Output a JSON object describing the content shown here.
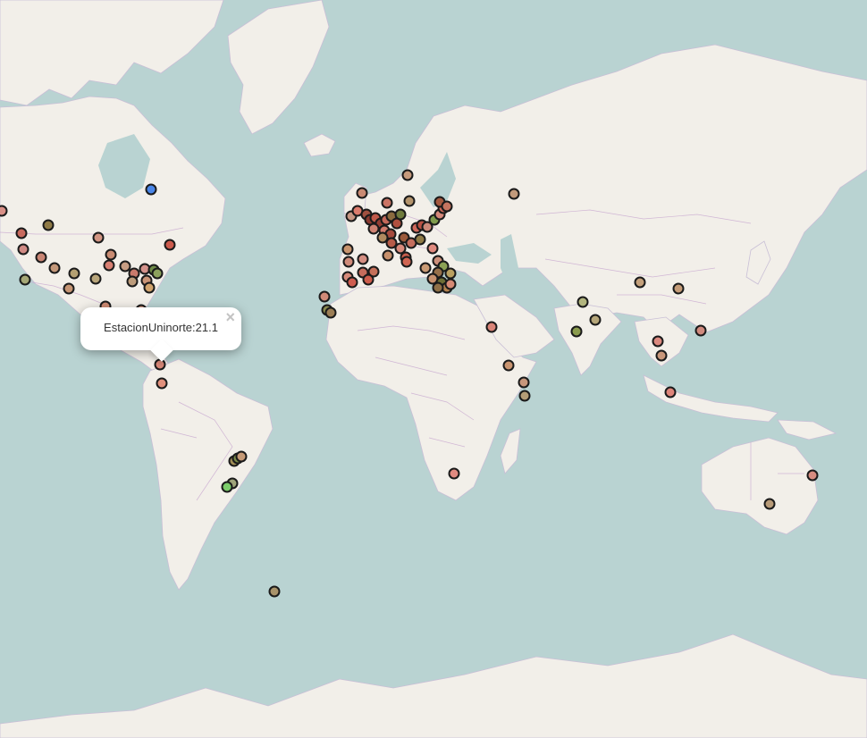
{
  "popup": {
    "text": "EstacionUninorte:21.1",
    "close_label": "×"
  },
  "colors": {
    "water": "#b9d3d2",
    "land": "#f2efe9",
    "border": "#c8a7cf",
    "marker_stroke": "#1a1a1a"
  },
  "map": {
    "region": "world",
    "projection": "mercator"
  }
}
